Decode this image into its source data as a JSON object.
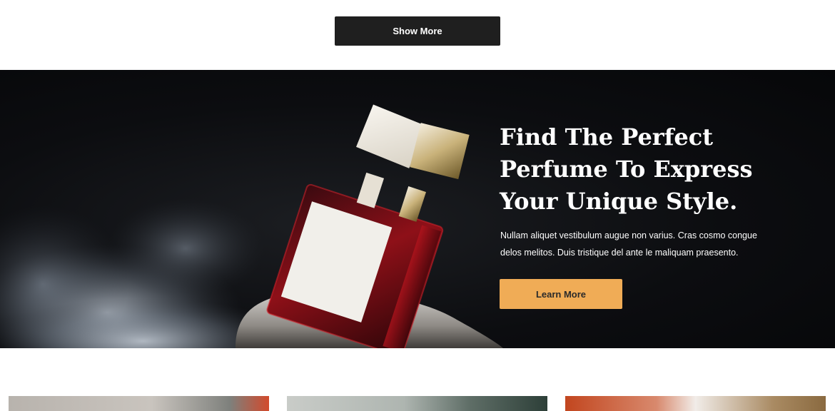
{
  "top": {
    "show_more_label": "Show More"
  },
  "hero": {
    "title_lines": [
      "Find The Perfect",
      "Perfume To Express",
      "Your Unique Style."
    ],
    "description_lines": [
      "Nullam aliquet vestibulum augue non varius. Cras cosmo congue",
      "delos melitos. Duis tristique del ante le maliquam praesento."
    ],
    "cta_label": "Learn More",
    "colors": {
      "background": "#0c0d10",
      "cta": "#f0ac56",
      "perfume_glass": "#7a0f14"
    }
  },
  "cards": [
    {
      "id": "card-1"
    },
    {
      "id": "card-2"
    },
    {
      "id": "card-3"
    }
  ]
}
